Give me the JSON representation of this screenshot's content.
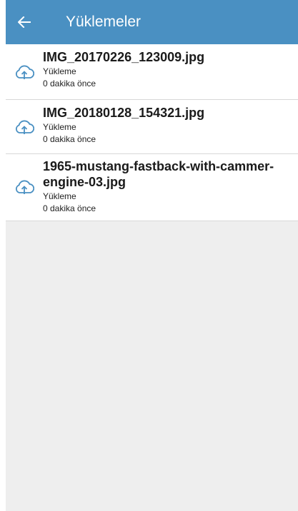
{
  "header": {
    "title": "Yüklemeler",
    "back_icon": "arrow-left-icon",
    "color": "#4a90c2"
  },
  "uploads": [
    {
      "filename": "IMG_20170226_123009.jpg",
      "status": "Yükleme",
      "time": "0 dakika önce",
      "icon": "cloud-upload-icon"
    },
    {
      "filename": "IMG_20180128_154321.jpg",
      "status": "Yükleme",
      "time": "0 dakika önce",
      "icon": "cloud-upload-icon"
    },
    {
      "filename": "1965-mustang-fastback-with-cammer-engine-03.jpg",
      "filename_line1": "1965-mustang-fastback-with-cammer-",
      "filename_line2": "engine-03.jpg",
      "status": "Yükleme",
      "time": "0 dakika önce",
      "icon": "cloud-upload-icon"
    }
  ],
  "colors": {
    "accent": "#4a90c2",
    "background": "#eeeeee"
  }
}
